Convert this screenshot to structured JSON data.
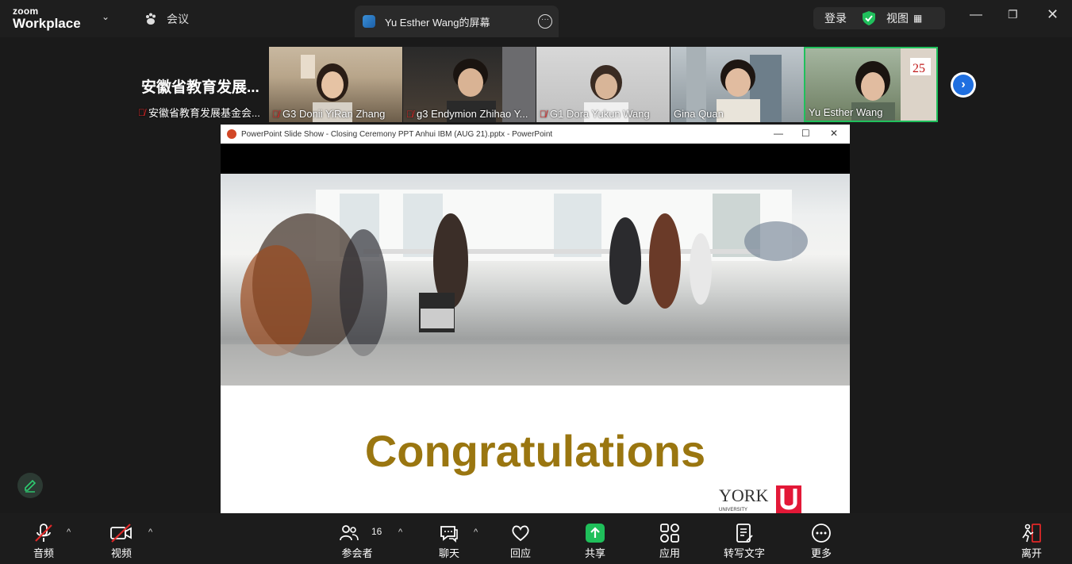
{
  "app": {
    "logo_small": "zoom",
    "logo_big": "Workplace",
    "meeting_menu": "会议"
  },
  "share_tab": {
    "title": "Yu Esther Wang的屏幕"
  },
  "header_right": {
    "login": "登录",
    "view": "视图"
  },
  "participants": {
    "group_title": "安徽省教育发展...",
    "tiles": [
      {
        "name": "安徽省教育发展基金会...",
        "muted": true
      },
      {
        "name": "G3 Donii YiRan Zhang",
        "muted": true
      },
      {
        "name": "g3 Endymion Zhihao Y...",
        "muted": true
      },
      {
        "name": "G1 Dora Yukun Wang",
        "muted": true
      },
      {
        "name": "Gina Quan",
        "muted": false
      },
      {
        "name": "Yu Esther Wang",
        "muted": false,
        "active_speaker": true
      }
    ]
  },
  "shared_window": {
    "title": "PowerPoint Slide Show  -  Closing Ceremony PPT Anhui IBM (AUG 21).pptx - PowerPoint",
    "slide_heading": "Congratulations",
    "logo_text": "YORK",
    "logo_sub": "UNIVERSITY"
  },
  "toolbar": {
    "audio": "音频",
    "video": "视频",
    "participants": "参会者",
    "participants_count": "16",
    "chat": "聊天",
    "react": "回应",
    "share": "共享",
    "apps": "应用",
    "transcript": "转写文字",
    "more": "更多",
    "leave": "离开"
  },
  "colors": {
    "accent_green": "#20c05c",
    "share_green": "#1fbf5a",
    "blue": "#1f6fe0",
    "mute_red": "#e02828",
    "gold": "#9a7610",
    "york_red": "#e31837"
  }
}
